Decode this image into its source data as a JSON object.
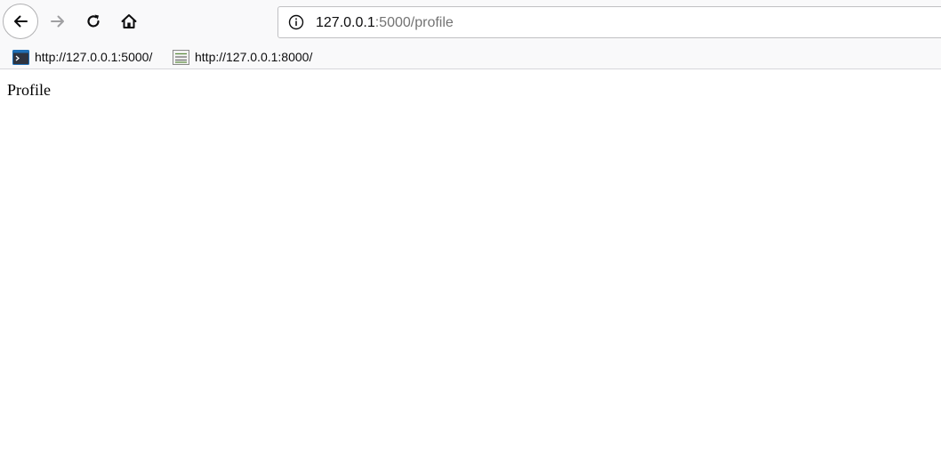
{
  "navigation": {
    "back_icon": "arrow-left-icon",
    "forward_icon": "arrow-right-icon",
    "reload_icon": "reload-icon",
    "home_icon": "home-icon"
  },
  "urlbar": {
    "info_icon": "info-icon",
    "host": "127.0.0.1",
    "path": ":5000/profile"
  },
  "bookmarks": [
    {
      "label": "http://127.0.0.1:5000/",
      "icon": "terminal-icon"
    },
    {
      "label": "http://127.0.0.1:8000/",
      "icon": "document-list-icon"
    }
  ],
  "page": {
    "title": "Profile"
  },
  "colors": {
    "toolbar_bg": "#f9f9fa",
    "url_host": "#0c0c0d",
    "url_path": "#737373",
    "disabled_icon": "#a0a0a2"
  }
}
